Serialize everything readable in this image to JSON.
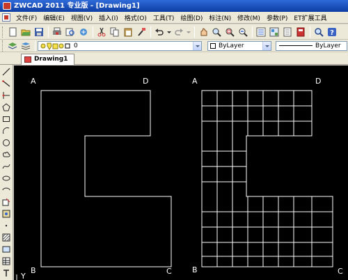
{
  "window": {
    "title": "ZWCAD 2011 专业版 - [Drawing1]"
  },
  "menu": {
    "items": [
      {
        "label": "文件(F)"
      },
      {
        "label": "编辑(E)"
      },
      {
        "label": "视图(V)"
      },
      {
        "label": "插入(I)"
      },
      {
        "label": "格式(O)"
      },
      {
        "label": "工具(T)"
      },
      {
        "label": "绘图(D)"
      },
      {
        "label": "标注(N)"
      },
      {
        "label": "修改(M)"
      },
      {
        "label": "参数(P)"
      },
      {
        "label": "ET扩展工具"
      }
    ]
  },
  "properties_bar": {
    "layer_value": "0",
    "color_value": "ByLayer",
    "linetype_value": "ByLayer"
  },
  "document_tabs": [
    {
      "label": "Drawing1"
    }
  ],
  "drawing": {
    "left_figure_labels": {
      "a": "A",
      "b": "B",
      "c": "C",
      "d": "D"
    },
    "right_figure_labels": {
      "a": "A",
      "b": "B",
      "c": "C",
      "d": "D"
    },
    "ucs_axis_label": "Y"
  },
  "colors": {
    "canvas_background": "#000000",
    "line_color": "#ffffff",
    "title_bar": "#1b4fb8",
    "chrome": "#ece9d8"
  }
}
